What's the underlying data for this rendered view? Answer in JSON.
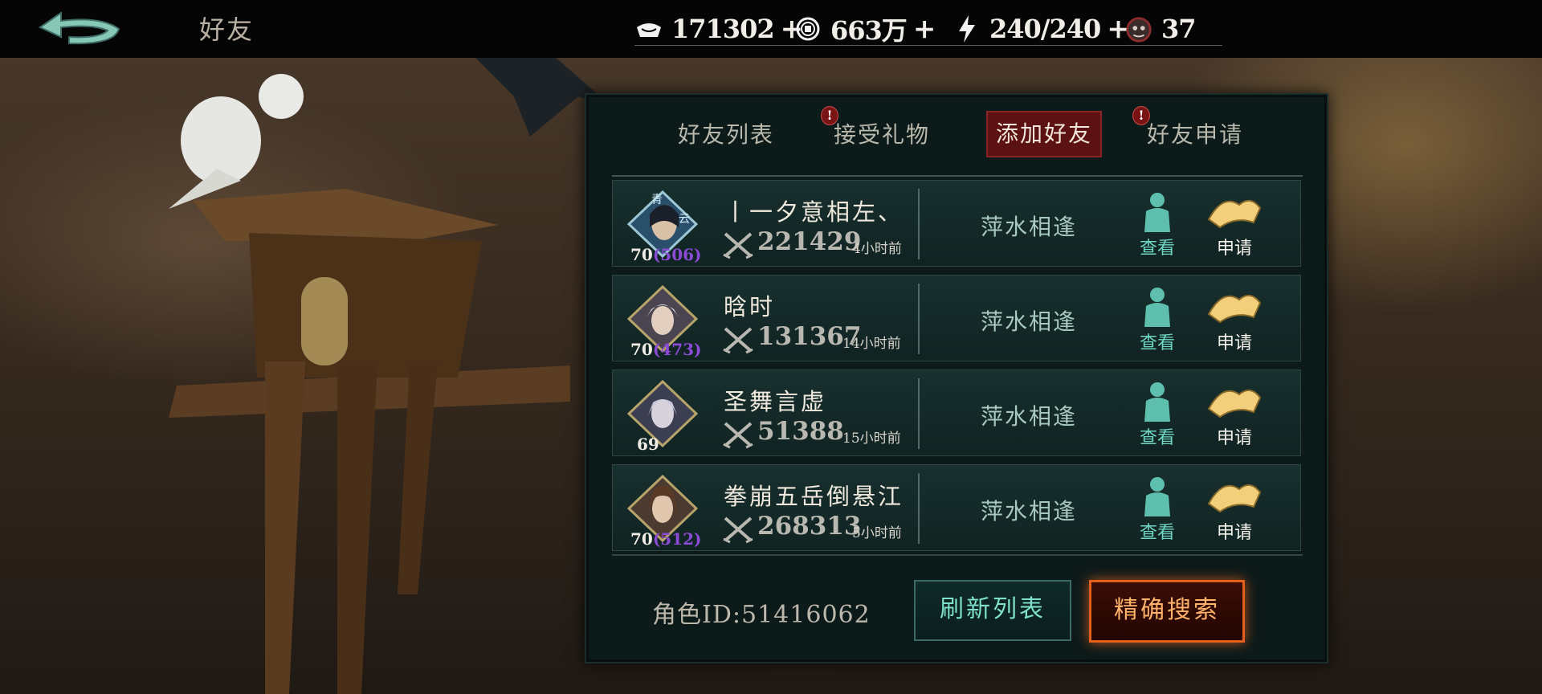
{
  "header": {
    "title": "好友",
    "back_icon": "back-arrow-icon",
    "resources": [
      {
        "icon": "silver-ingot-icon",
        "value": "171302",
        "plus": "+"
      },
      {
        "icon": "copper-coin-icon",
        "value": "663万",
        "plus": "+"
      },
      {
        "icon": "lightning-icon",
        "value": "240/240",
        "plus": "+"
      },
      {
        "icon": "ghost-token-icon",
        "value": "37"
      }
    ]
  },
  "tabs": [
    {
      "label": "好友列表",
      "active": false,
      "alert": false
    },
    {
      "label": "接受礼物",
      "active": false,
      "alert": true,
      "alert_text": "!"
    },
    {
      "label": "添加好友",
      "active": true,
      "alert": false
    },
    {
      "label": "好友申请",
      "active": false,
      "alert": true,
      "alert_text": "!"
    }
  ],
  "friends": [
    {
      "name": "丨一夕意相左、",
      "level": "70",
      "power": "(506)",
      "score": "221429",
      "time": "4小时前",
      "status": "萍水相逢",
      "view": "查看",
      "apply": "申请"
    },
    {
      "name": "晗时",
      "level": "70",
      "power": "(473)",
      "score": "131367",
      "time": "14小时前",
      "status": "萍水相逢",
      "view": "查看",
      "apply": "申请"
    },
    {
      "name": "圣舞言虚",
      "level": "69",
      "power": "",
      "score": "51388",
      "time": "15小时前",
      "status": "萍水相逢",
      "view": "查看",
      "apply": "申请"
    },
    {
      "name": "拳崩五岳倒悬江",
      "level": "70",
      "power": "(512)",
      "score": "268313",
      "time": "5小时前",
      "status": "萍水相逢",
      "view": "查看",
      "apply": "申请"
    }
  ],
  "footer": {
    "role_id": "角色ID:51416062",
    "refresh": "刷新列表",
    "precise_search": "精确搜索"
  },
  "colors": {
    "panel_bg": "#0d1a1a",
    "active_tab": "#5c1112",
    "view_label": "#6ed6c3",
    "power_purple": "#8b4bd6",
    "search_border": "#e2601c"
  }
}
